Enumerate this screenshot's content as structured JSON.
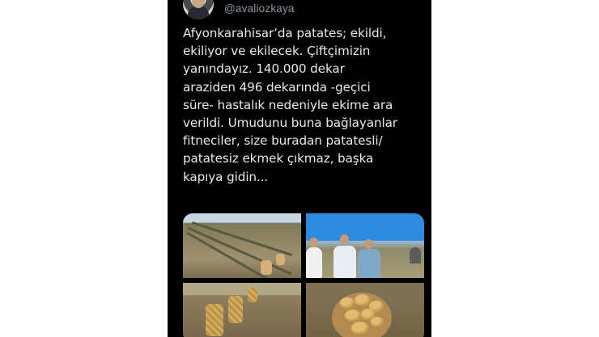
{
  "tweet": {
    "handle": "@avaliozkaya",
    "text": "Afyonkarahisar’da patates; ekildi,\nekiliyor ve ekilecek. Çiftçimizin\nyanındayız. 140.000 dekar\naraziden 496 dekarında -geçici\nsüre- hastalık nedeniyle ekime ara\nverildi. Umudunu buna bağlayanlar\nfitneciler, size buradan patatesli/\npatatesiz ekmek çıkmaz, başka\nkapıya gidin..."
  },
  "colors": {
    "background": "#000000",
    "text": "#e7e9ea",
    "handle": "#8b98a5"
  }
}
